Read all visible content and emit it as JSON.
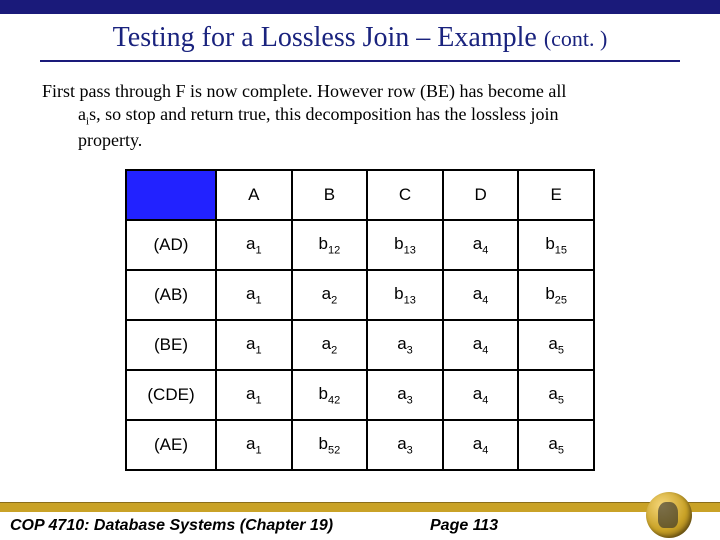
{
  "title_main": "Testing for a Lossless Join – Example ",
  "title_cont": "(cont. )",
  "body_line1": "First pass through F is now complete.  However row (BE) has become all",
  "body_line2_a": "a",
  "body_line2_sub": "i",
  "body_line2_b": "s, so stop and return true, this decomposition has the lossless join",
  "body_line3": "property.",
  "columns": [
    "A",
    "B",
    "C",
    "D",
    "E"
  ],
  "rows": [
    {
      "label": "(AD)",
      "cells": [
        [
          "a",
          "1"
        ],
        [
          "b",
          "12"
        ],
        [
          "b",
          "13"
        ],
        [
          "a",
          "4"
        ],
        [
          "b",
          "15"
        ]
      ]
    },
    {
      "label": "(AB)",
      "cells": [
        [
          "a",
          "1"
        ],
        [
          "a",
          "2"
        ],
        [
          "b",
          "13"
        ],
        [
          "a",
          "4"
        ],
        [
          "b",
          "25"
        ]
      ]
    },
    {
      "label": "(BE)",
      "cells": [
        [
          "a",
          "1"
        ],
        [
          "a",
          "2"
        ],
        [
          "a",
          "3"
        ],
        [
          "a",
          "4"
        ],
        [
          "a",
          "5"
        ]
      ]
    },
    {
      "label": "(CDE)",
      "cells": [
        [
          "a",
          "1"
        ],
        [
          "b",
          "42"
        ],
        [
          "a",
          "3"
        ],
        [
          "a",
          "4"
        ],
        [
          "a",
          "5"
        ]
      ]
    },
    {
      "label": "(AE)",
      "cells": [
        [
          "a",
          "1"
        ],
        [
          "b",
          "52"
        ],
        [
          "a",
          "3"
        ],
        [
          "a",
          "4"
        ],
        [
          "a",
          "5"
        ]
      ]
    }
  ],
  "footer_left": "COP 4710: Database Systems  (Chapter 19)",
  "footer_page": "Page 113"
}
